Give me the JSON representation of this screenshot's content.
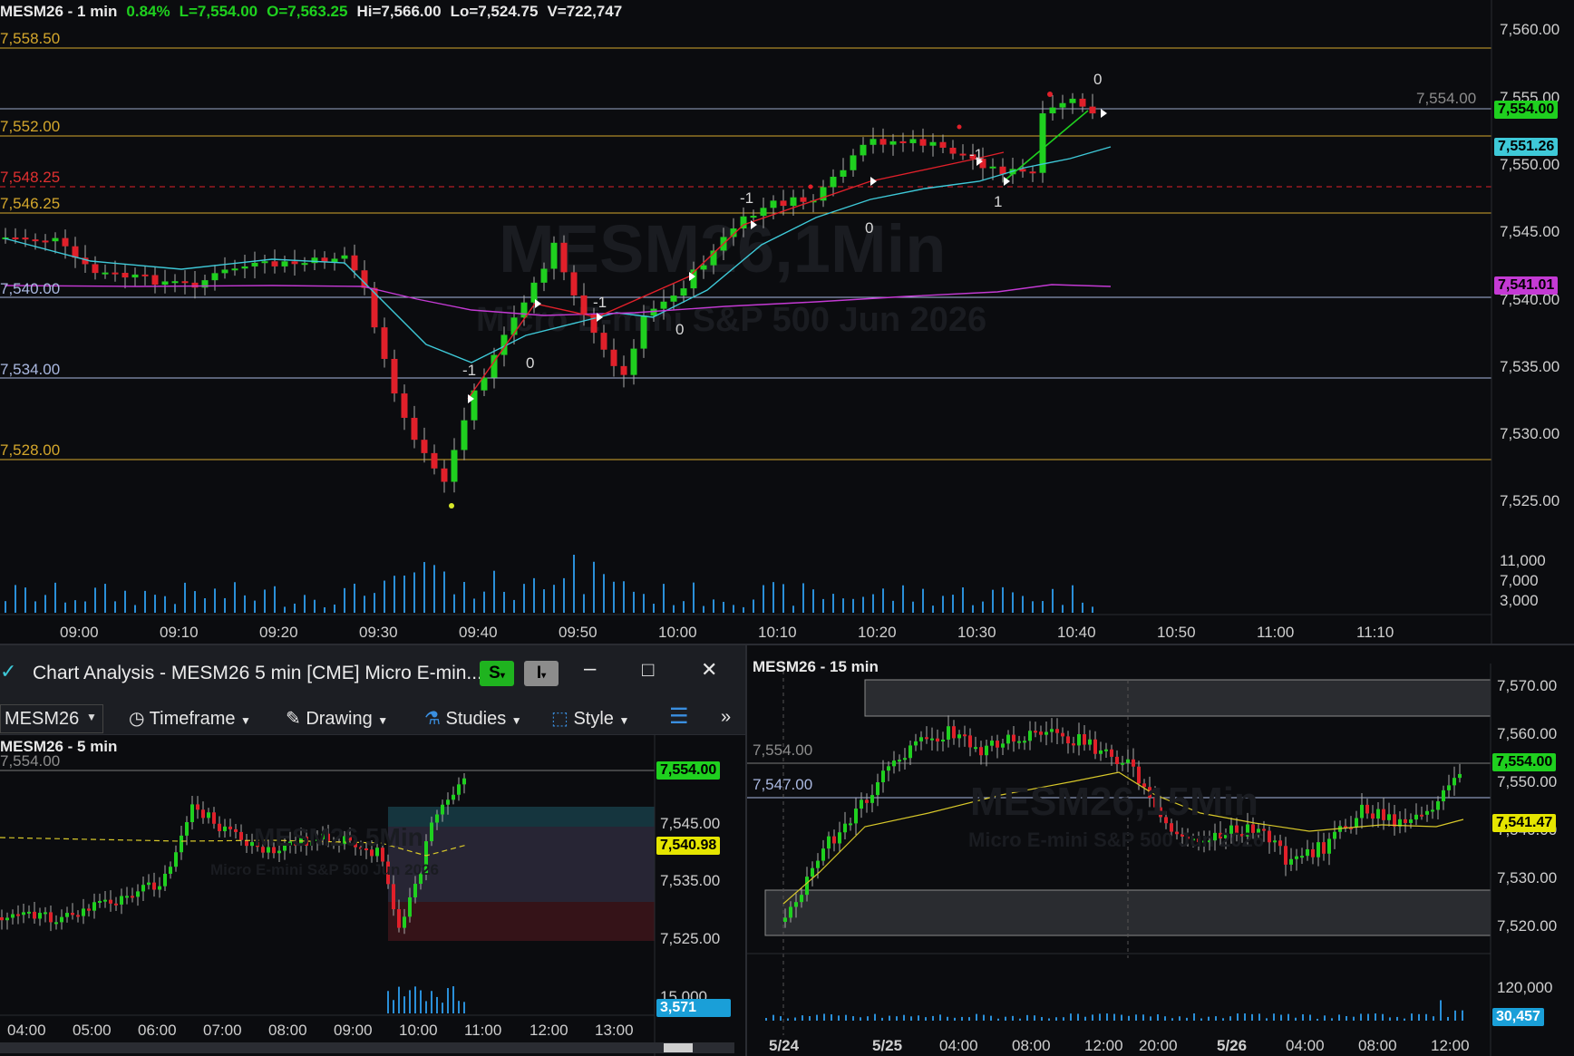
{
  "top_chart": {
    "header": {
      "symbol": "MESM26 - 1 min",
      "change": "0.84%",
      "last": "L=7,554.00",
      "open": "O=7,563.25",
      "high": "Hi=7,566.00",
      "low": "Lo=7,524.75",
      "volume": "V=722,747"
    },
    "watermark": {
      "main": "MESM26,1Min",
      "sub": "Micro E-mini S&P 500 Jun 2026"
    },
    "hlines": [
      {
        "label": "7,558.50",
        "color": "#d4a72c"
      },
      {
        "label": "7,552.00",
        "color": "#d4a72c"
      },
      {
        "label": "7,548.25",
        "color": "#e03030"
      },
      {
        "label": "7,546.25",
        "color": "#d4a72c"
      },
      {
        "label": "7,540.00",
        "color": "#aab8e0"
      },
      {
        "label": "7,534.00",
        "color": "#aab8e0"
      },
      {
        "label": "7,528.00",
        "color": "#d4a72c"
      }
    ],
    "price_axis": [
      "7,560.00",
      "7,555.00",
      "7,550.00",
      "7,545.00",
      "7,540.00",
      "7,535.00",
      "7,530.00",
      "7,525.00"
    ],
    "volume_axis": [
      "11,000",
      "7,000",
      "3,000"
    ],
    "time_axis": [
      "09:00",
      "09:10",
      "09:20",
      "09:30",
      "09:40",
      "09:50",
      "10:00",
      "10:10",
      "10:20",
      "10:30",
      "10:40",
      "10:50",
      "11:00",
      "11:10"
    ],
    "tags": {
      "last_price_gray": "7,554.00",
      "last_price": "7,554.00",
      "ema_fast": "7,551.26",
      "ema_slow": "7,541.01"
    },
    "wave_labels": [
      "-1",
      "0",
      "-1",
      "0",
      "-1",
      "0",
      "-1",
      "1",
      "0"
    ]
  },
  "left_window": {
    "title": "Chart Analysis - MESM26 5 min [CME] Micro E-min...",
    "s_button": "S",
    "i_button": "I",
    "minimize": "–",
    "maximize": "□",
    "close": "✕",
    "toolbar": {
      "symbol": "MESM26",
      "timeframe": "Timeframe",
      "drawing": "Drawing",
      "studies": "Studies",
      "style": "Style",
      "more": "»"
    },
    "chart": {
      "header": "MESM26 - 5 min",
      "cut_label": "7,554.00",
      "watermark_main": "MESM26,5Min",
      "watermark_sub": "Micro E-mini S&P 500 Jun 2026",
      "price_axis": [
        "7,545.00",
        "7,535.00",
        "7,525.00"
      ],
      "volume_axis_top": "15,000",
      "tags": {
        "last": "7,554.00",
        "ma": "7,540.98",
        "volume": "3,571"
      },
      "time_axis": [
        "04:00",
        "05:00",
        "06:00",
        "07:00",
        "08:00",
        "09:00",
        "10:00",
        "11:00",
        "12:00",
        "13:00"
      ]
    }
  },
  "right_window": {
    "header": "MESM26 - 15 min",
    "watermark_main": "MESM26,15Min",
    "watermark_sub": "Micro E-mini S&P 500 Jun 2026",
    "hline_labels": [
      "7,554.00",
      "7,547.00"
    ],
    "price_axis": [
      "7,570.00",
      "7,560.00",
      "7,550.00",
      "7,540.00",
      "7,530.00",
      "7,520.00"
    ],
    "volume_axis": "120,000",
    "tags": {
      "last": "7,554.00",
      "ma": "7,541.47",
      "volume": "30,457"
    },
    "time_axis": [
      "5/24",
      "5/25",
      "04:00",
      "08:00",
      "12:00",
      "20:00",
      "5/26",
      "04:00",
      "08:00",
      "12:00"
    ]
  },
  "colors": {
    "up": "#1fd01f",
    "down": "#e0202a",
    "ema_fast": "#3ec9d8",
    "ema_slow": "#c43ad4",
    "ma_yellow": "#d8c82a",
    "volume": "#2a8fd8",
    "gold": "#d4a72c"
  }
}
